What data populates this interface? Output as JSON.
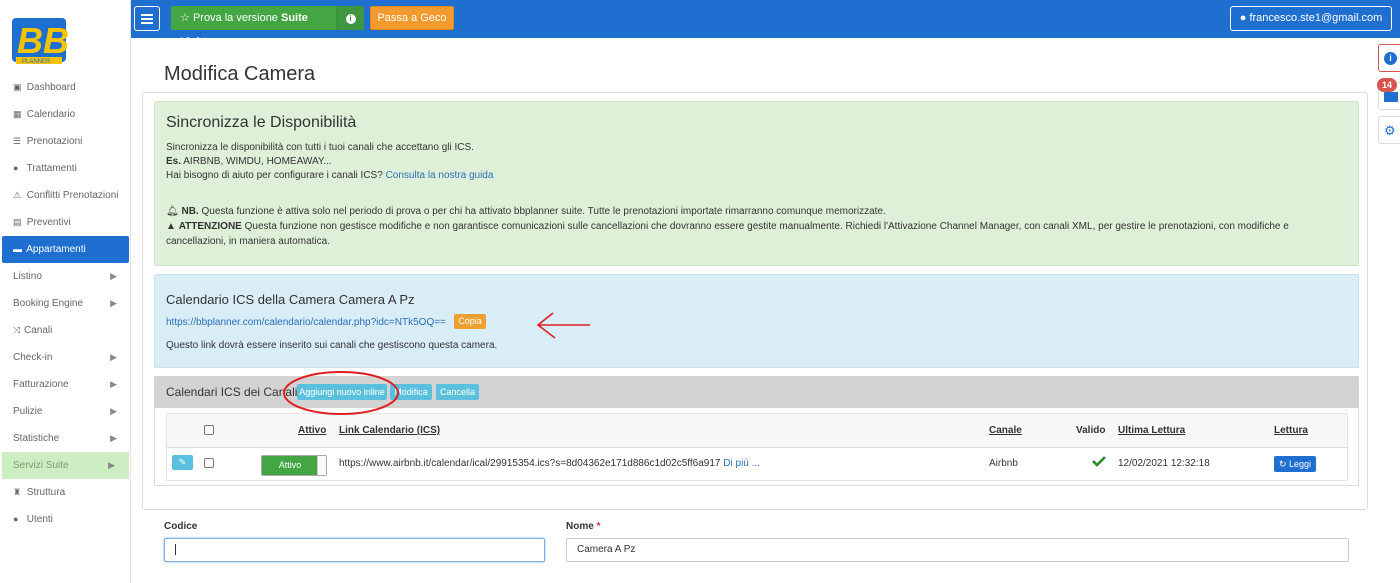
{
  "logo": {
    "text": "BB",
    "sub": "PLANNER"
  },
  "sidebar": {
    "items": [
      {
        "label": "Dashboard",
        "icon": "▣"
      },
      {
        "label": "Calendario",
        "icon": "▦"
      },
      {
        "label": "Prenotazioni",
        "icon": "☰"
      },
      {
        "label": "Trattamenti",
        "icon": "●"
      },
      {
        "label": "Conflitti Prenotazioni",
        "icon": "⚠"
      },
      {
        "label": "Preventivi",
        "icon": "▤"
      },
      {
        "label": "Appartamenti",
        "icon": "▬"
      },
      {
        "label": "Listino",
        "icon": ""
      },
      {
        "label": "Booking Engine",
        "icon": ""
      },
      {
        "label": "Canali",
        "icon": "⤨"
      },
      {
        "label": "Check-in",
        "icon": ""
      },
      {
        "label": "Fatturazione",
        "icon": ""
      },
      {
        "label": "Pulizie",
        "icon": ""
      },
      {
        "label": "Statistiche",
        "icon": ""
      },
      {
        "label": "Servizi Suite",
        "icon": ""
      },
      {
        "label": "Struttura",
        "icon": "♜"
      },
      {
        "label": "Utenti",
        "icon": "●"
      }
    ]
  },
  "topbar": {
    "suite_prefix": "Prova la versione ",
    "suite_bold": "Suite Light",
    "geco": "Passa a Geco",
    "user": "francesco.ste1@gmail.com"
  },
  "right_tabs": {
    "mail_count": "14"
  },
  "page": {
    "title": "Modifica Camera"
  },
  "sync": {
    "title": "Sincronizza le Disponibilità",
    "line1": "Sincronizza le disponibilità con tutti i tuoi canali che accettano gli ICS.",
    "es_label": "Es.",
    "es_text": " AIRBNB, WIMDU, HOMEAWAY...",
    "help_text": "Hai bisogno di aiuto per configurare i canali ICS? ",
    "help_link": "Consulta la nostra guida",
    "nb_label": "NB.",
    "nb_text": " Questa funzione è attiva solo nel periodo di prova o per chi ha attivato bbplanner suite. Tutte le prenotazioni importate rimarranno comunque memorizzate.",
    "att_label": "ATTENZIONE",
    "att_text": " Questa funzione non gestisce modifiche e non garantisce comunicazioni sulle cancellazioni che dovranno essere gestite manualmente. Richiedi l'Attivazione Channel Manager, con canali XML, per gestire le prenotazioni, con modifiche e",
    "att_text2": "cancellazioni, in maniera automatica."
  },
  "ics": {
    "title": "Calendario ICS della Camera Camera A Pz",
    "link": "https://bbplanner.com/calendario/calendar.php?idc=NTk5OQ==",
    "copy": "Copia",
    "note": "Questo link dovrà essere inserito sui canali che gestiscono questa camera."
  },
  "channels": {
    "title": "Calendari ICS dei Canali",
    "add": "Aggiungi nuovo inline",
    "edit": "Modifica",
    "delete": "Cancella",
    "columns": {
      "active": "Attivo",
      "link": "Link Calendario (ICS)",
      "channel": "Canale",
      "valid": "Valido",
      "last": "Ultima Lettura",
      "read": "Lettura"
    },
    "rows": [
      {
        "active": "Attivo",
        "link": "https://www.airbnb.it/calendar/ical/29915354.ics?s=8d04362e171d886c1d02c5ff6a917 ",
        "more": "Di più ...",
        "channel": "Airbnb",
        "last": "12/02/2021 12:32:18",
        "read": "Leggi"
      }
    ]
  },
  "form": {
    "code_label": "Codice",
    "code_value": "",
    "name_label": "Nome",
    "name_req": "*",
    "name_value": "Camera A Pz"
  },
  "colors": {
    "primary": "#1f6fd1",
    "success": "#43a643",
    "warning": "#f29a2e",
    "annotation": "#e02020"
  }
}
